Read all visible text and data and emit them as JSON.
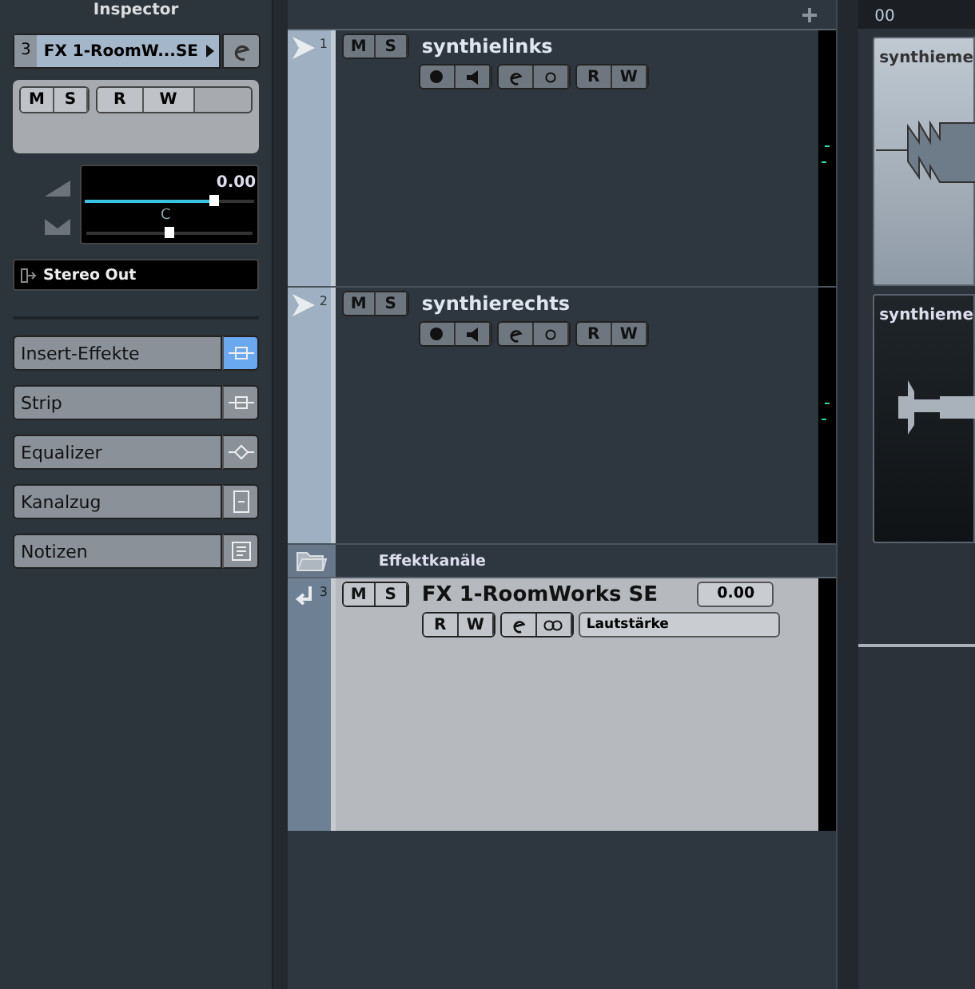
{
  "inspector": {
    "title": "Inspector",
    "channel": {
      "number": "3",
      "name": "FX 1-RoomW...SE"
    },
    "ms_buttons": [
      "M",
      "S"
    ],
    "rw_buttons": [
      "R",
      "W"
    ],
    "volume": {
      "reading": "0.00",
      "level": 0.76
    },
    "pan": {
      "reading": "C",
      "level": 0.5
    },
    "output": "Stereo Out",
    "sections": [
      {
        "label": "Insert-Effekte",
        "kind": "insert",
        "active": true
      },
      {
        "label": "Strip",
        "kind": "insert",
        "active": false
      },
      {
        "label": "Equalizer",
        "kind": "eq",
        "active": false
      },
      {
        "label": "Kanalzug",
        "kind": "channel",
        "active": false
      },
      {
        "label": "Notizen",
        "kind": "notes",
        "active": false
      }
    ]
  },
  "tracks": [
    {
      "kind": "audio",
      "number": "1",
      "name": "synthielinks",
      "selected": false,
      "buttons": [
        "M",
        "S",
        "R",
        "W"
      ]
    },
    {
      "kind": "audio",
      "number": "2",
      "name": "synthierechts",
      "selected": false,
      "buttons": [
        "M",
        "S",
        "R",
        "W"
      ]
    },
    {
      "kind": "folder",
      "name": "Effektkanäle"
    },
    {
      "kind": "fx",
      "number": "3",
      "name": "FX 1-RoomWorks SE",
      "selected": true,
      "buttons": [
        "M",
        "S",
        "R",
        "W"
      ],
      "value": "0.00",
      "automation": "Lautstärke"
    }
  ],
  "arrange": {
    "ruler": "00",
    "events": [
      {
        "name": "synthieme",
        "selected": true
      },
      {
        "name": "synthieme",
        "selected": false
      }
    ]
  }
}
